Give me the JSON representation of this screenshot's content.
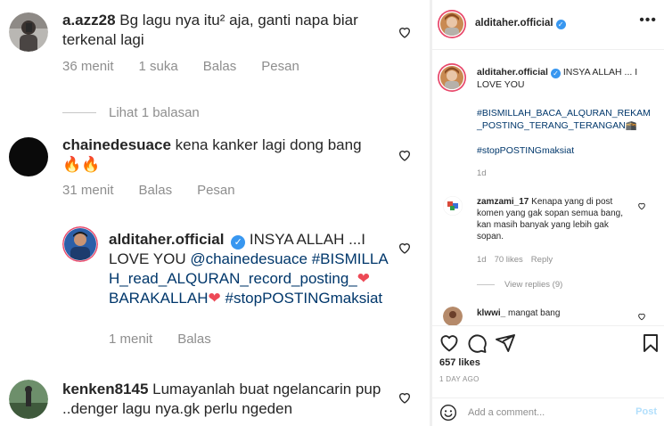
{
  "left": {
    "comments": [
      {
        "username": "a.azz28",
        "text": "Bg lagu nya itu² aja, ganti napa biar terkenal lagi",
        "time": "36 menit",
        "likes": "1 suka",
        "reply": "Balas",
        "message": "Pesan",
        "view_replies": "Lihat 1 balasan"
      },
      {
        "username": "chainedesuace",
        "text": "kena kanker lagi dong bang",
        "emoji": "🔥🔥",
        "time": "31 menit",
        "reply": "Balas",
        "message": "Pesan"
      },
      {
        "username": "alditaher.official",
        "text_a": "INSYA ALLAH ...I LOVE YOU ",
        "mention": "@chainedesuace",
        "tag1": "#BISMILLAH_read_ALQURAN_record_posting_",
        "heart1": "❤",
        "tag1b": "BARAKALLAH",
        "heart2": "❤",
        "tag2": "#stopPOSTINGmaksiat",
        "time": "1 menit",
        "reply": "Balas"
      },
      {
        "username": "kenken8145",
        "text": "Lumayanlah buat ngelancarin pup ..denger lagu nya.gk perlu ngeden"
      }
    ]
  },
  "right": {
    "header": {
      "username": "alditaher.official",
      "more": "•••"
    },
    "caption": {
      "username": "alditaher.official",
      "text": "INSYA ALLAH ... I LOVE YOU",
      "tags1": "#BISMILLAH_BACA_ALQURAN_REKAM_POSTING_TERANG_TERANGAN",
      "tags1_suffix": "🕋",
      "tags2": "#stopPOSTINGmaksiat",
      "age": "1d"
    },
    "comments": [
      {
        "username": "zamzami_17",
        "text": "Kenapa yang di post komen yang gak sopan semua bang, kan masih banyak yang lebih gak sopan.",
        "age": "1d",
        "likes": "70 likes",
        "reply": "Reply",
        "view_replies": "View replies (9)"
      },
      {
        "username": "klwwi_",
        "text": "mangat bang"
      }
    ],
    "likes": "657 likes",
    "date": "1 DAY AGO",
    "add_comment_placeholder": "Add a comment...",
    "post_label": "Post"
  },
  "colors": {
    "accent": "#3897f0",
    "tag": "#00376b",
    "muted": "#8e8e8e",
    "heart": "#ed4956",
    "post_disabled": "#b2dffc"
  }
}
